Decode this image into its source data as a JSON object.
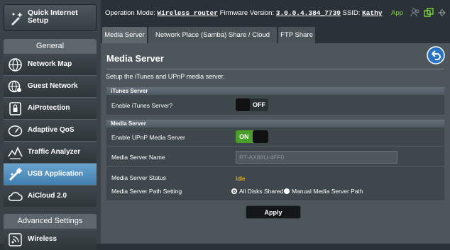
{
  "sidebar": {
    "quick_setup": "Quick Internet Setup",
    "general_label": "General",
    "items": [
      {
        "label": "Network Map",
        "icon": "globe-icon"
      },
      {
        "label": "Guest Network",
        "icon": "guest-globe-icon"
      },
      {
        "label": "AiProtection",
        "icon": "lock-icon"
      },
      {
        "label": "Adaptive QoS",
        "icon": "gauge-icon"
      },
      {
        "label": "Traffic Analyzer",
        "icon": "traffic-icon"
      },
      {
        "label": "USB Application",
        "icon": "usb-icon",
        "active": true
      },
      {
        "label": "AiCloud 2.0",
        "icon": "cloud-icon"
      }
    ],
    "advanced_label": "Advanced Settings",
    "advanced_items": [
      {
        "label": "Wireless",
        "icon": "wireless-icon"
      }
    ]
  },
  "topbar": {
    "mode_label": "Operation Mode:",
    "mode_value": "Wireless router",
    "fw_label": "Firmware Version:",
    "fw_value": "3.0.0.4.384_7739",
    "ssid_label": "SSID:",
    "ssid_value": "Kathy",
    "app_label": "App"
  },
  "tabs": [
    {
      "label": "Media Server",
      "active": true
    },
    {
      "label": "Network Place (Samba) Share / Cloud Disk"
    },
    {
      "label": "FTP Share"
    }
  ],
  "panel": {
    "title": "Media Server",
    "description": "Setup the iTunes and UPnP media server.",
    "itunes_header": "iTunes Server",
    "itunes_enable_label": "Enable iTunes Server?",
    "itunes_toggle": "OFF",
    "media_header": "Media Server",
    "upnp_enable_label": "Enable UPnP Media Server",
    "upnp_toggle": "ON",
    "name_label": "Media Server Name",
    "name_value": "RT-AX88U-4FF0",
    "status_label": "Media Server Status",
    "status_value": "Idle",
    "path_label": "Media Server Path Setting",
    "path_option_all": "All Disks Shared",
    "path_option_manual": "Manual Media Server Path",
    "apply_label": "Apply"
  },
  "colors": {
    "accent_green": "#7fd43b",
    "active_nav": "#4a8fc2",
    "status_yellow": "#ffc61e",
    "toggle_on": "#4a9e2a"
  }
}
